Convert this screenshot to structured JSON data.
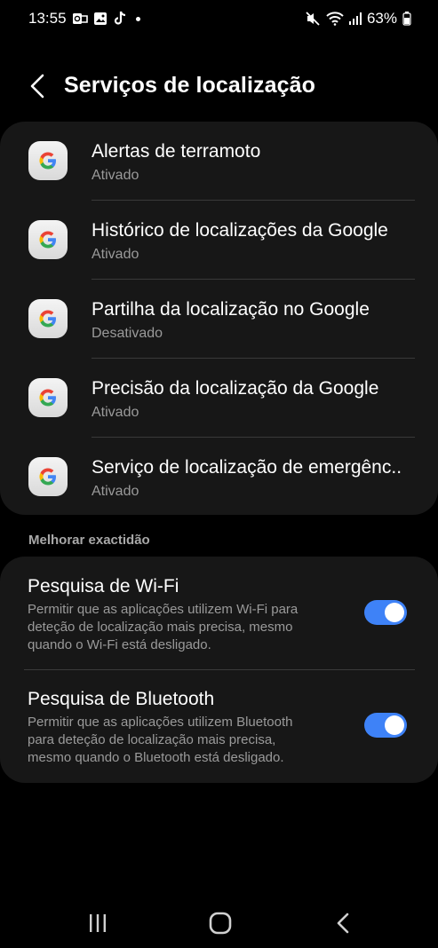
{
  "status_bar": {
    "time": "13:55",
    "battery": "63%"
  },
  "header": {
    "title": "Serviços de localização"
  },
  "services": [
    {
      "title": "Alertas de terramoto",
      "status": "Ativado"
    },
    {
      "title": "Histórico de localizações da Google",
      "status": "Ativado"
    },
    {
      "title": "Partilha da localização no Google",
      "status": "Desativado"
    },
    {
      "title": "Precisão da localização da Google",
      "status": "Ativado"
    },
    {
      "title": "Serviço de localização de emergênc..",
      "status": "Ativado"
    }
  ],
  "section": {
    "label": "Melhorar exactidão"
  },
  "accuracy": {
    "wifi": {
      "title": "Pesquisa de Wi-Fi",
      "line1": "Permitir que as aplicações utilizem Wi-Fi para",
      "line2": "deteção de localização mais precisa, mesmo",
      "line3": "quando o Wi-Fi está desligado.",
      "enabled": true
    },
    "bluetooth": {
      "title": "Pesquisa de Bluetooth",
      "line1": "Permitir que as aplicações utilizem Bluetooth",
      "line2": "para deteção de localização mais precisa,",
      "line3": "mesmo quando o Bluetooth está desligado.",
      "enabled": true
    }
  },
  "colors": {
    "accent": "#3e82f7",
    "card": "#171717",
    "background": "#000000"
  }
}
